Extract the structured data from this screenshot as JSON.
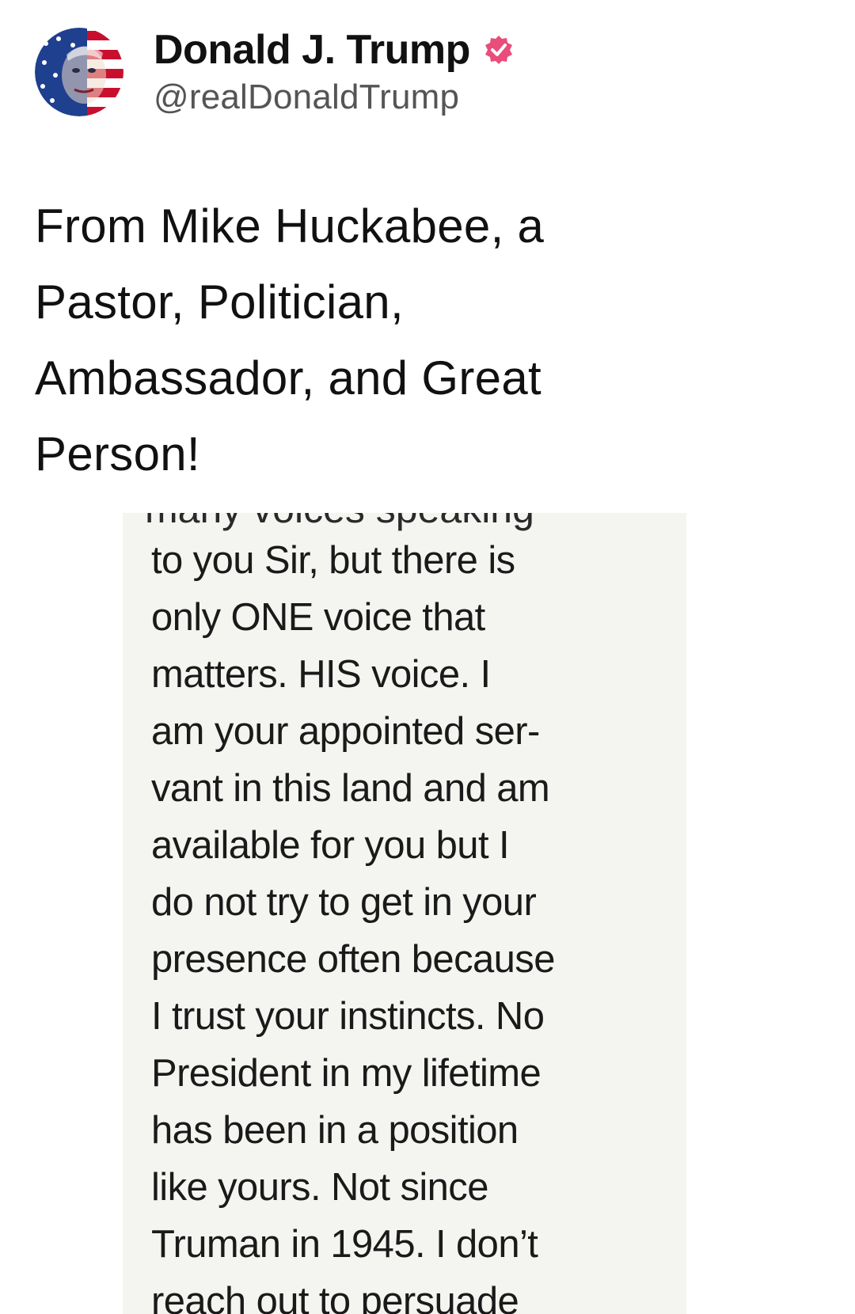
{
  "author": {
    "display_name": "Donald J. Trump",
    "handle": "@realDonaldTrump",
    "verified_badge_color": "#e84d7b",
    "avatar_icon": "avatar-flag-portrait"
  },
  "post": {
    "text_lines": [
      "From Mike Huckabee, a",
      "Pastor, Politician,",
      "Ambassador, and Great",
      "Person!"
    ]
  },
  "embedded_image": {
    "cut_off_top_line": "many voices speaking",
    "lines": [
      "to you Sir, but there is",
      "only ONE voice that",
      "matters.  HIS voice.  I",
      "am your appointed ser-",
      "vant in this land and am",
      "available for you but I",
      "do not try to get in your",
      "presence often because",
      "I trust your instincts.  No",
      "President in my lifetime",
      "has been in a position",
      "like yours.  Not since",
      "Truman in 1945.  I don’t",
      "reach out to persuade"
    ]
  }
}
